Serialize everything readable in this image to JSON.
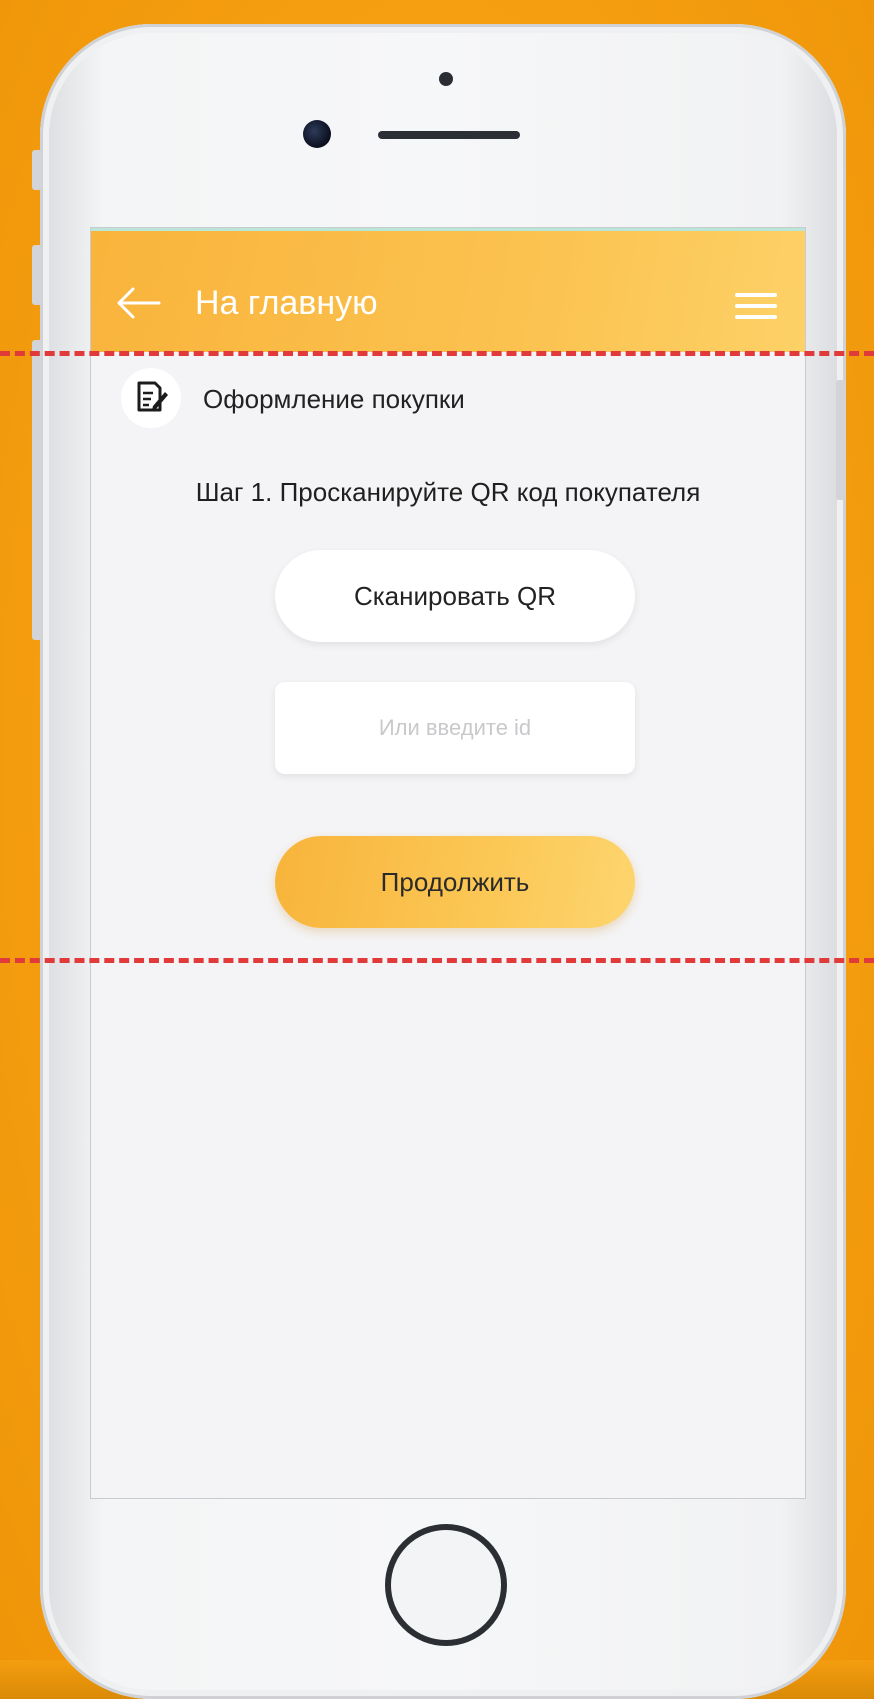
{
  "appbar": {
    "back_icon": "arrow-left-icon",
    "title": "На главную",
    "menu_icon": "hamburger-menu-icon"
  },
  "section": {
    "icon": "document-edit-icon",
    "title": "Оформление покупки"
  },
  "step": {
    "text": "Шаг 1. Просканируйте QR код покупателя"
  },
  "buttons": {
    "scan_label": "Сканировать QR",
    "continue_label": "Продолжить"
  },
  "id_field": {
    "placeholder": "Или введите id",
    "value": ""
  },
  "colors": {
    "background": "#f7a112",
    "accent": "#fbc24f",
    "highlight_dash": "#e03a3a"
  }
}
